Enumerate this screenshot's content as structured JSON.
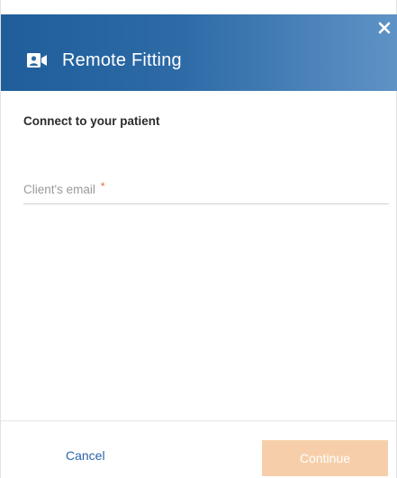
{
  "dialog": {
    "title": "Remote Fitting",
    "header_icon": "video-camera-icon",
    "close_icon": "close-icon",
    "subtitle": "Connect to your patient"
  },
  "form": {
    "email_label": "Client's email",
    "email_required_marker": "*",
    "email_value": ""
  },
  "footer": {
    "cancel_label": "Cancel",
    "continue_label": "Continue",
    "continue_enabled": false
  },
  "colors": {
    "header_start": "#1f5e9b",
    "header_end": "#5f93c6",
    "link": "#2a64a8",
    "required": "#e86a2b",
    "continue_disabled_bg": "#f6cfaa"
  }
}
